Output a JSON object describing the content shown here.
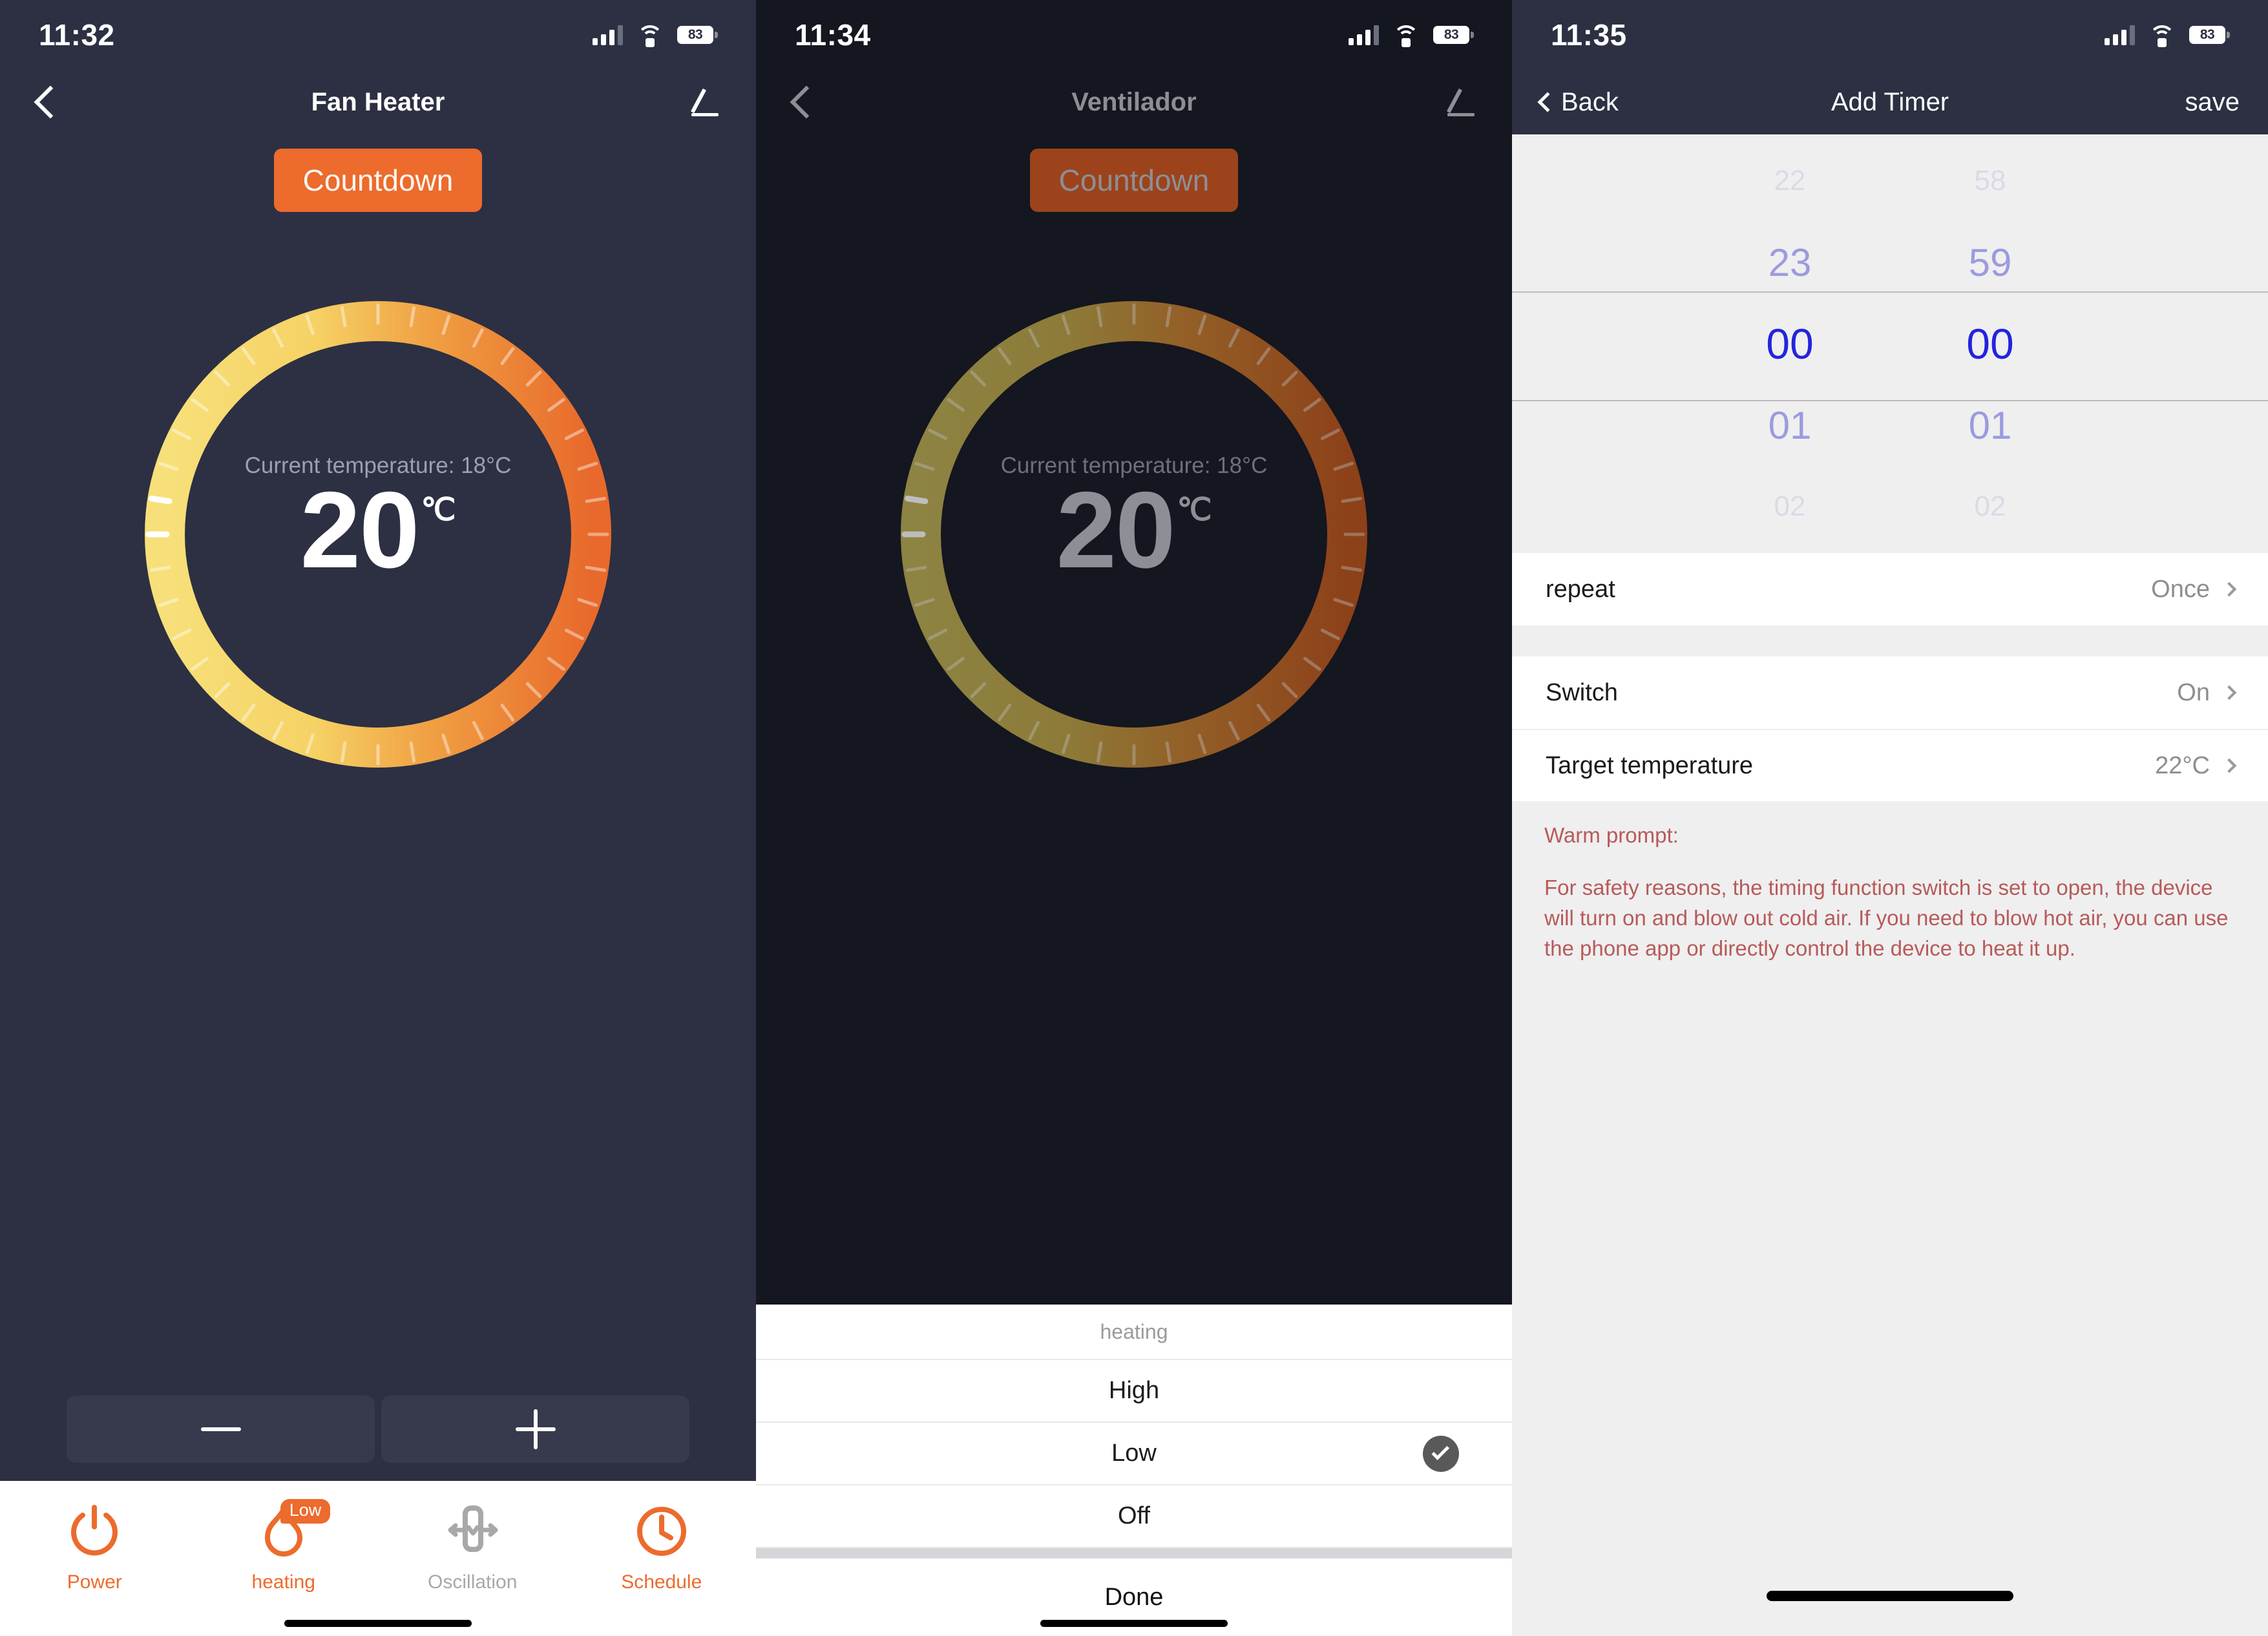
{
  "panel1": {
    "status": {
      "time": "11:32",
      "battery": "83"
    },
    "nav": {
      "title": "Fan Heater",
      "back_icon": "chevron-left-icon",
      "edit_icon": "pencil-icon"
    },
    "countdown_label": "Countdown",
    "dial": {
      "current_temperature_text": "Current temperature: 18°C",
      "set_value": "20",
      "unit": "℃",
      "gradient_start": "#f5dd6e",
      "gradient_end": "#e8692b",
      "track_color": "#4b5062"
    },
    "stepper": {
      "minus": "minus-icon",
      "plus": "plus-icon"
    },
    "tabs": [
      {
        "label": "Power",
        "icon": "power-icon",
        "active": true,
        "badge": ""
      },
      {
        "label": "heating",
        "icon": "flame-icon",
        "active": true,
        "badge": "Low"
      },
      {
        "label": "Oscillation",
        "icon": "oscillation-icon",
        "active": false,
        "badge": ""
      },
      {
        "label": "Schedule",
        "icon": "clock-icon",
        "active": true,
        "badge": ""
      }
    ]
  },
  "panel2": {
    "status": {
      "time": "11:34",
      "battery": "83"
    },
    "nav": {
      "title": "Ventilador",
      "back_icon": "chevron-left-icon",
      "edit_icon": "pencil-icon"
    },
    "countdown_label": "Countdown",
    "dial": {
      "current_temperature_text": "Current temperature: 18°C",
      "set_value": "20",
      "unit": "℃"
    },
    "sheet": {
      "title": "heating",
      "options": [
        {
          "label": "High",
          "selected": false
        },
        {
          "label": "Low",
          "selected": true
        },
        {
          "label": "Off",
          "selected": false
        }
      ],
      "done_label": "Done"
    }
  },
  "panel3": {
    "status": {
      "time": "11:35",
      "battery": "83"
    },
    "nav": {
      "back_label": "Back",
      "title": "Add Timer",
      "save_label": "save"
    },
    "picker": {
      "hours": [
        "22",
        "23",
        "00",
        "01",
        "02"
      ],
      "minutes": [
        "58",
        "59",
        "00",
        "01",
        "02"
      ],
      "selected_index": 2,
      "selected_hour": "00",
      "selected_minute": "00",
      "selected_color": "#2323dd"
    },
    "rows": [
      {
        "label": "repeat",
        "value": "Once"
      },
      {
        "label": "Switch",
        "value": "On"
      },
      {
        "label": "Target temperature",
        "value": "22°C"
      }
    ],
    "warn": {
      "heading": "Warm prompt:",
      "body": "For safety reasons, the timing function switch is set to open, the device will turn on and blow out cold air. If you need to blow hot air, you can use the phone app or directly control the device to heat it up.",
      "color": "#b85a5a"
    }
  }
}
